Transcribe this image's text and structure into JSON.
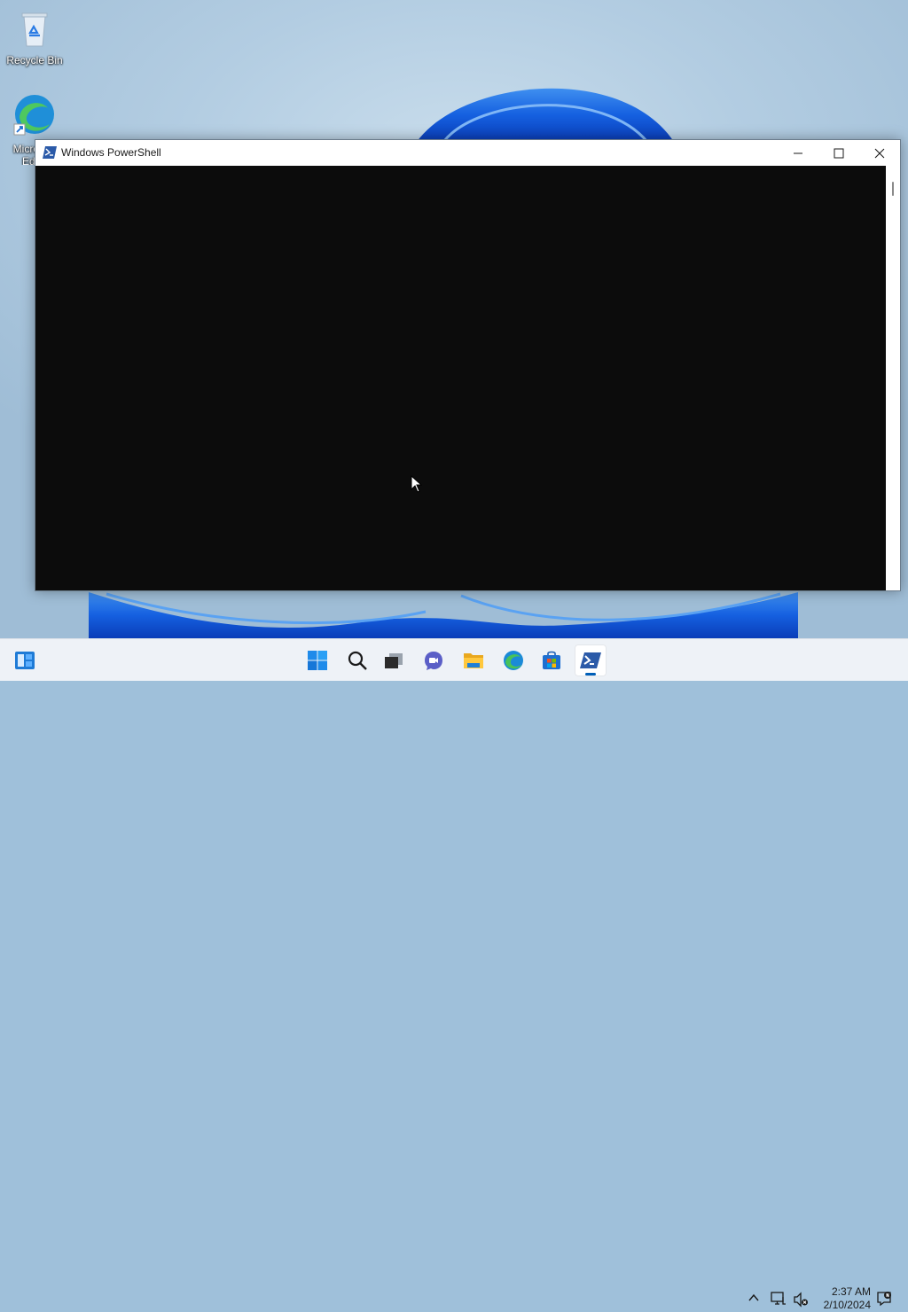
{
  "desktop": {
    "icons": [
      {
        "label": "Recycle Bin",
        "icon": "recycle-bin-icon"
      },
      {
        "label": "Microsoft Edge",
        "icon": "edge-icon"
      }
    ]
  },
  "window": {
    "title": "Windows PowerShell",
    "icon": "powershell-icon",
    "controls": [
      "minimize-icon",
      "maximize-icon",
      "close-icon"
    ],
    "console_bg": "#0c0c0c"
  },
  "taskbar": {
    "pinned": [
      {
        "name": "start",
        "icon": "windows-logo-icon"
      },
      {
        "name": "search",
        "icon": "search-icon"
      },
      {
        "name": "task-view",
        "icon": "task-view-icon"
      },
      {
        "name": "chat",
        "icon": "chat-icon"
      },
      {
        "name": "file-explorer",
        "icon": "folder-icon"
      },
      {
        "name": "edge",
        "icon": "edge-icon"
      },
      {
        "name": "store",
        "icon": "store-icon"
      },
      {
        "name": "powershell",
        "icon": "powershell-icon",
        "active": true
      }
    ],
    "tray": {
      "time": "2:37 AM",
      "date": "2/10/2024",
      "icons": [
        "chevron-up-icon",
        "network-icon",
        "volume-muted-icon",
        "notification-icon"
      ]
    }
  },
  "colors": {
    "accent": "#005fb8",
    "taskbar_bg": "#eef2f7"
  }
}
